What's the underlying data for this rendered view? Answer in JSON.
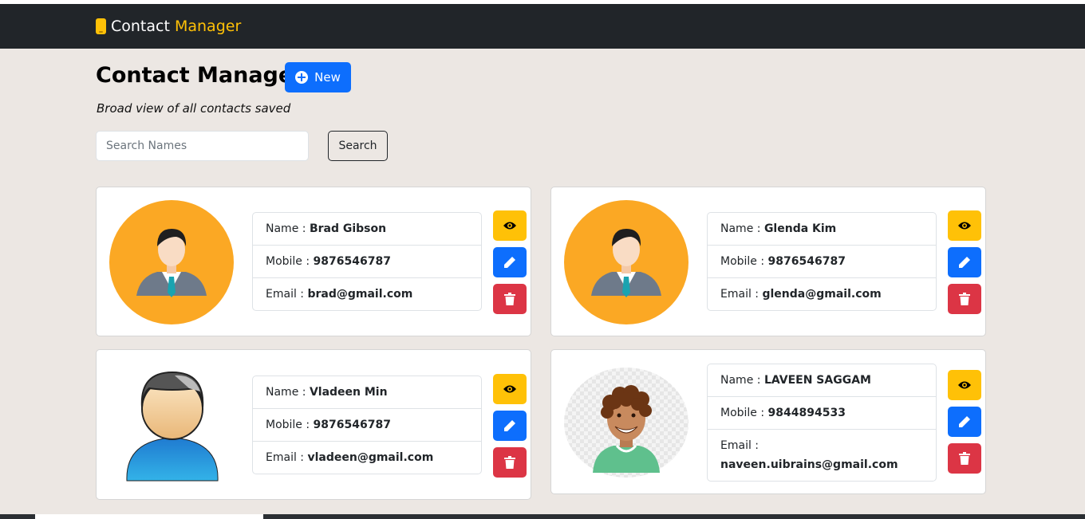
{
  "navbar": {
    "brand_first": "Contact",
    "brand_second": "Manager",
    "brand_icon": "mobile-phone-icon"
  },
  "header": {
    "title": "Contact Manager",
    "new_label": "New",
    "subtitle": "Broad view of all contacts saved"
  },
  "search": {
    "placeholder": "Search Names",
    "value": "",
    "button_label": "Search"
  },
  "labels": {
    "name": "Name :",
    "mobile": "Mobile :",
    "email": "Email :"
  },
  "contacts": [
    {
      "name": "Brad Gibson",
      "mobile": "9876546787",
      "email": "brad@gmail.com",
      "avatar": "businessman-avatar"
    },
    {
      "name": "Glenda Kim",
      "mobile": "9876546787",
      "email": "glenda@gmail.com",
      "avatar": "businessman-avatar"
    },
    {
      "name": "Vladeen Min",
      "mobile": "9876546787",
      "email": "vladeen@gmail.com",
      "avatar": "cartoon-man-avatar"
    },
    {
      "name": "LAVEEN SAGGAM",
      "mobile": "9844894533",
      "email": "naveen.uibrains@gmail.com",
      "avatar": "curly-hair-avatar"
    }
  ],
  "colors": {
    "navbar": "#212529",
    "accent": "#ffc107",
    "primary": "#0d6efd",
    "danger": "#dc3545",
    "page_bg": "#ece7e3"
  },
  "icons": {
    "view": "eye-icon",
    "edit": "pencil-icon",
    "delete": "trash-icon"
  }
}
